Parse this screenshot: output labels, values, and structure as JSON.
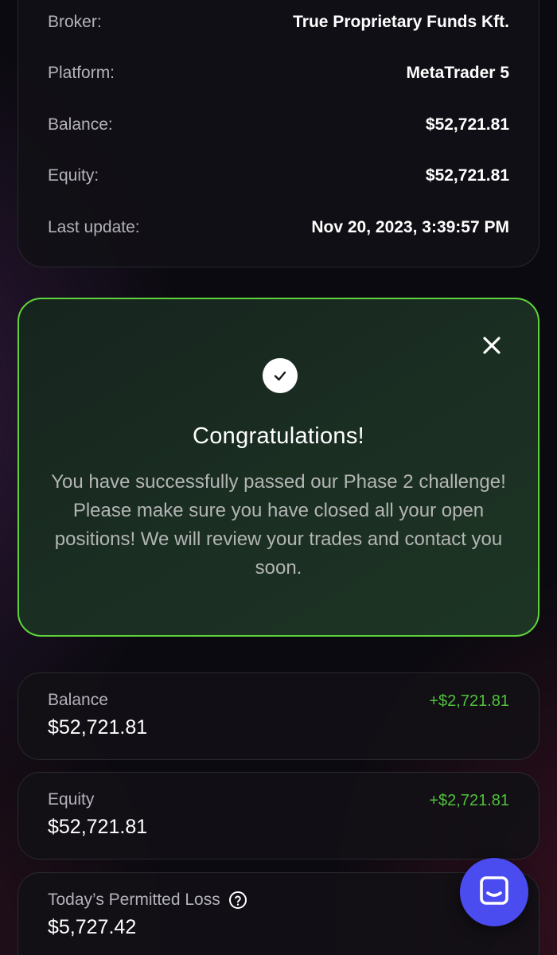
{
  "account_details": {
    "rows": [
      {
        "label": "Broker:",
        "value": "True Proprietary Funds Kft."
      },
      {
        "label": "Platform:",
        "value": "MetaTrader 5"
      },
      {
        "label": "Balance:",
        "value": "$52,721.81"
      },
      {
        "label": "Equity:",
        "value": "$52,721.81"
      },
      {
        "label": "Last update:",
        "value": "Nov 20, 2023, 3:39:57 PM"
      }
    ]
  },
  "notice": {
    "title": "Congratulations!",
    "message": "You have successfully passed our Phase 2 challenge! Please make sure you have closed all your open positions! We will review your trades and contact you soon.",
    "close_icon": "close-icon",
    "status_icon": "check-icon",
    "border_color": "#5ed43a"
  },
  "stats": {
    "balance": {
      "label": "Balance",
      "value": "$52,721.81",
      "change": "+$2,721.81"
    },
    "equity": {
      "label": "Equity",
      "value": "$52,721.81",
      "change": "+$2,721.81"
    },
    "permitted_loss": {
      "label": "Today’s Permitted Loss",
      "value": "$5,727.42",
      "help_icon": "question-circle-icon"
    }
  },
  "chat": {
    "icon": "chat-icon",
    "color": "#4a4cf0"
  },
  "colors": {
    "positive": "#4fc23a",
    "accent": "#5ed43a"
  }
}
